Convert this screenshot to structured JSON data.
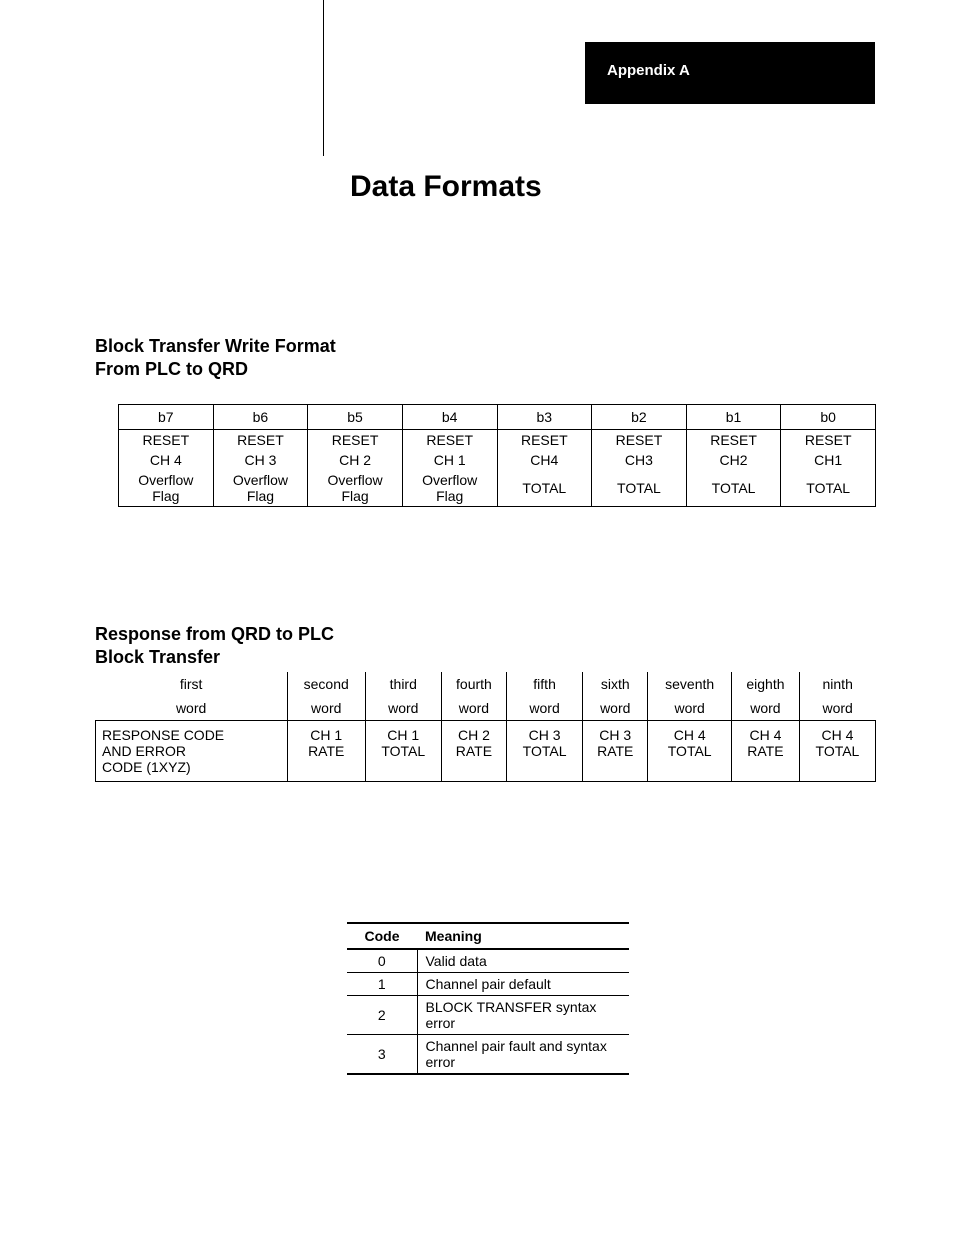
{
  "header": {
    "appendix": "Appendix A"
  },
  "title": "Data Formats",
  "section1": {
    "heading_line1": "Block Transfer Write Format",
    "heading_line2": "From PLC to QRD",
    "columns": [
      "b7",
      "b6",
      "b5",
      "b4",
      "b3",
      "b2",
      "b1",
      "b0"
    ],
    "row1": [
      "RESET",
      "RESET",
      "RESET",
      "RESET",
      "RESET",
      "RESET",
      "RESET",
      "RESET"
    ],
    "row2": [
      "CH 4",
      "CH 3",
      "CH 2",
      "CH 1",
      "CH4",
      "CH3",
      "CH2",
      "CH1"
    ],
    "row3": [
      "Overflow Flag",
      "Overflow Flag",
      "Overflow Flag",
      "Overflow Flag",
      "TOTAL",
      "TOTAL",
      "TOTAL",
      "TOTAL"
    ]
  },
  "section2": {
    "heading_line1": "Response from QRD to PLC",
    "heading_line2": "Block Transfer",
    "head_row1": [
      "first",
      "second",
      "third",
      "fourth",
      "fifth",
      "sixth",
      "seventh",
      "eighth",
      "ninth"
    ],
    "head_row2": [
      "word",
      "word",
      "word",
      "word",
      "word",
      "word",
      "word",
      "word",
      "word"
    ],
    "body_line1": [
      "RESPONSE CODE",
      "CH 1",
      "CH 1",
      "CH 2",
      "CH 3",
      "CH 3",
      "CH 4",
      "CH 4",
      "CH 4"
    ],
    "body_line2": [
      "AND ERROR",
      "RATE",
      "TOTAL",
      "RATE",
      "TOTAL",
      "RATE",
      "TOTAL",
      "RATE",
      "TOTAL"
    ],
    "body_line3": [
      "CODE (1XYZ)",
      "",
      "",
      "",
      "",
      "",
      "",
      "",
      ""
    ]
  },
  "codes": {
    "head_code": "Code",
    "head_meaning": "Meaning",
    "rows": [
      {
        "code": "0",
        "meaning": "Valid data"
      },
      {
        "code": "1",
        "meaning": "Channel pair default"
      },
      {
        "code": "2",
        "meaning": "BLOCK TRANSFER syntax error"
      },
      {
        "code": "3",
        "meaning": "Channel pair fault and syntax error"
      }
    ]
  }
}
